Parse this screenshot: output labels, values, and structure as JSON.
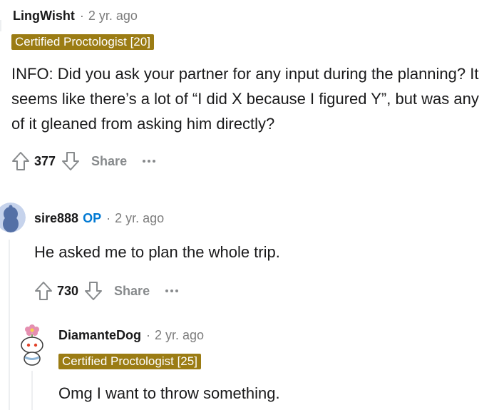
{
  "comments": [
    {
      "author": "LingWisht",
      "time": "2 yr. ago",
      "flair": "Certified Proctologist [20]",
      "body": "INFO: Did you ask your partner for any input during the planning? It seems like there’s a lot of “I did X because I figured Y”, but was any of it gleaned from asking him directly?",
      "votes": "377",
      "share_label": "Share"
    },
    {
      "author": "sire888",
      "op_label": "OP",
      "time": "2 yr. ago",
      "body": "He asked me to plan the whole trip.",
      "votes": "730",
      "share_label": "Share",
      "avatar_icon": "snoo-avatar-icon"
    },
    {
      "author": "DiamanteDog",
      "time": "2 yr. ago",
      "flair": "Certified Proctologist [25]",
      "body": "Omg I want to throw something.",
      "avatar_icon": "snoo-flower-avatar-icon"
    }
  ],
  "separator": "·",
  "colors": {
    "flair_bg": "#9b7c14",
    "op_blue": "#0079d3",
    "muted": "#7c7c7c"
  }
}
